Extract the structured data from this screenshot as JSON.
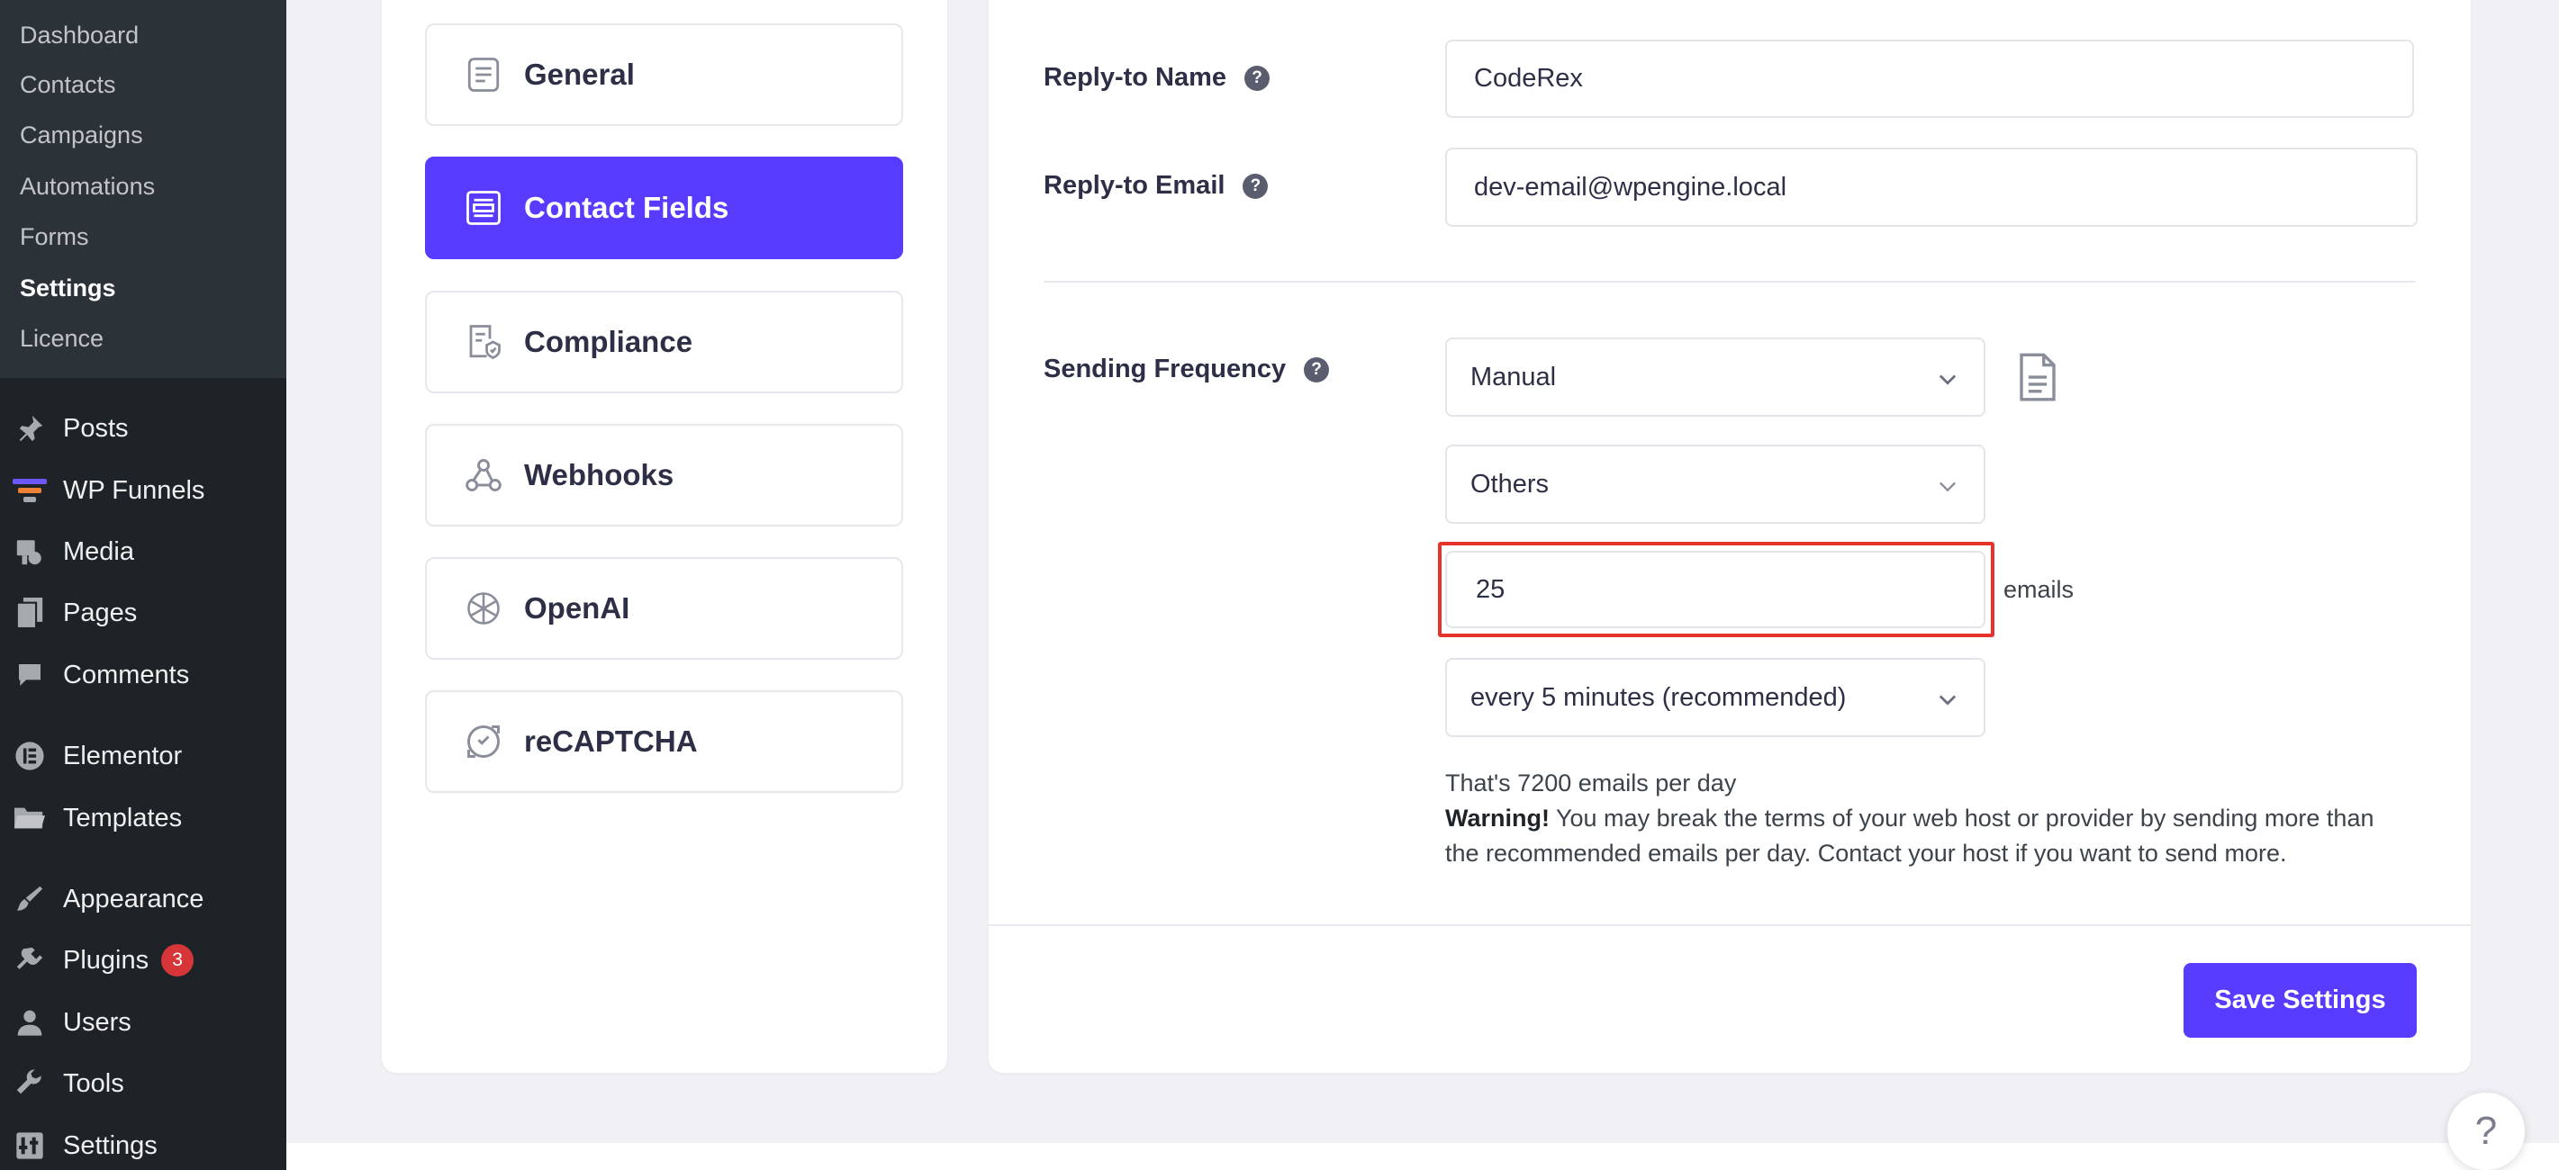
{
  "wp_submenu": [
    {
      "label": "Dashboard",
      "current": false
    },
    {
      "label": "Contacts",
      "current": false
    },
    {
      "label": "Campaigns",
      "current": false
    },
    {
      "label": "Automations",
      "current": false
    },
    {
      "label": "Forms",
      "current": false
    },
    {
      "label": "Settings",
      "current": true
    },
    {
      "label": "Licence",
      "current": false
    }
  ],
  "wp_menu": [
    {
      "label": "Posts",
      "icon": "pin-icon"
    },
    {
      "label": "WP Funnels",
      "icon": "funnel-icon"
    },
    {
      "label": "Media",
      "icon": "media-icon"
    },
    {
      "label": "Pages",
      "icon": "pages-icon"
    },
    {
      "label": "Comments",
      "icon": "comment-icon"
    },
    {
      "label": "Elementor",
      "icon": "elementor-icon"
    },
    {
      "label": "Templates",
      "icon": "folder-icon"
    },
    {
      "label": "Appearance",
      "icon": "brush-icon"
    },
    {
      "label": "Plugins",
      "icon": "plug-icon",
      "badge": "3"
    },
    {
      "label": "Users",
      "icon": "user-icon"
    },
    {
      "label": "Tools",
      "icon": "wrench-icon"
    },
    {
      "label": "Settings",
      "icon": "settings-icon"
    }
  ],
  "settings_nav": [
    {
      "label": "General",
      "icon": "general-icon",
      "active": false
    },
    {
      "label": "Contact Fields",
      "icon": "contact-fields-icon",
      "active": true
    },
    {
      "label": "Compliance",
      "icon": "compliance-icon",
      "active": false
    },
    {
      "label": "Webhooks",
      "icon": "webhooks-icon",
      "active": false
    },
    {
      "label": "OpenAI",
      "icon": "openai-icon",
      "active": false
    },
    {
      "label": "reCAPTCHA",
      "icon": "recaptcha-icon",
      "active": false
    }
  ],
  "form": {
    "reply_to_name": {
      "label": "Reply-to Name",
      "value": "CodeRex"
    },
    "reply_to_email": {
      "label": "Reply-to Email",
      "value": "dev-email@wpengine.local"
    },
    "sending_frequency": {
      "label": "Sending Frequency",
      "mode_select": "Manual",
      "provider_select": "Others",
      "emails_count": "25",
      "emails_suffix": "emails",
      "interval_select": "every 5 minutes (recommended)"
    },
    "info_line": "That's 7200 emails per day",
    "warning_strong": "Warning!",
    "warning_line1": " You may break the terms of your web host or provider by sending more than",
    "warning_line2": "the recommended emails per day. Contact your host if you want to send more."
  },
  "save_button": "Save Settings",
  "help_fab": "?",
  "colors": {
    "accent": "#573bff",
    "sidebar_bg": "#1d2327",
    "submenu_bg": "#2c3338",
    "highlight": "#e8322c",
    "badge": "#d63638"
  }
}
